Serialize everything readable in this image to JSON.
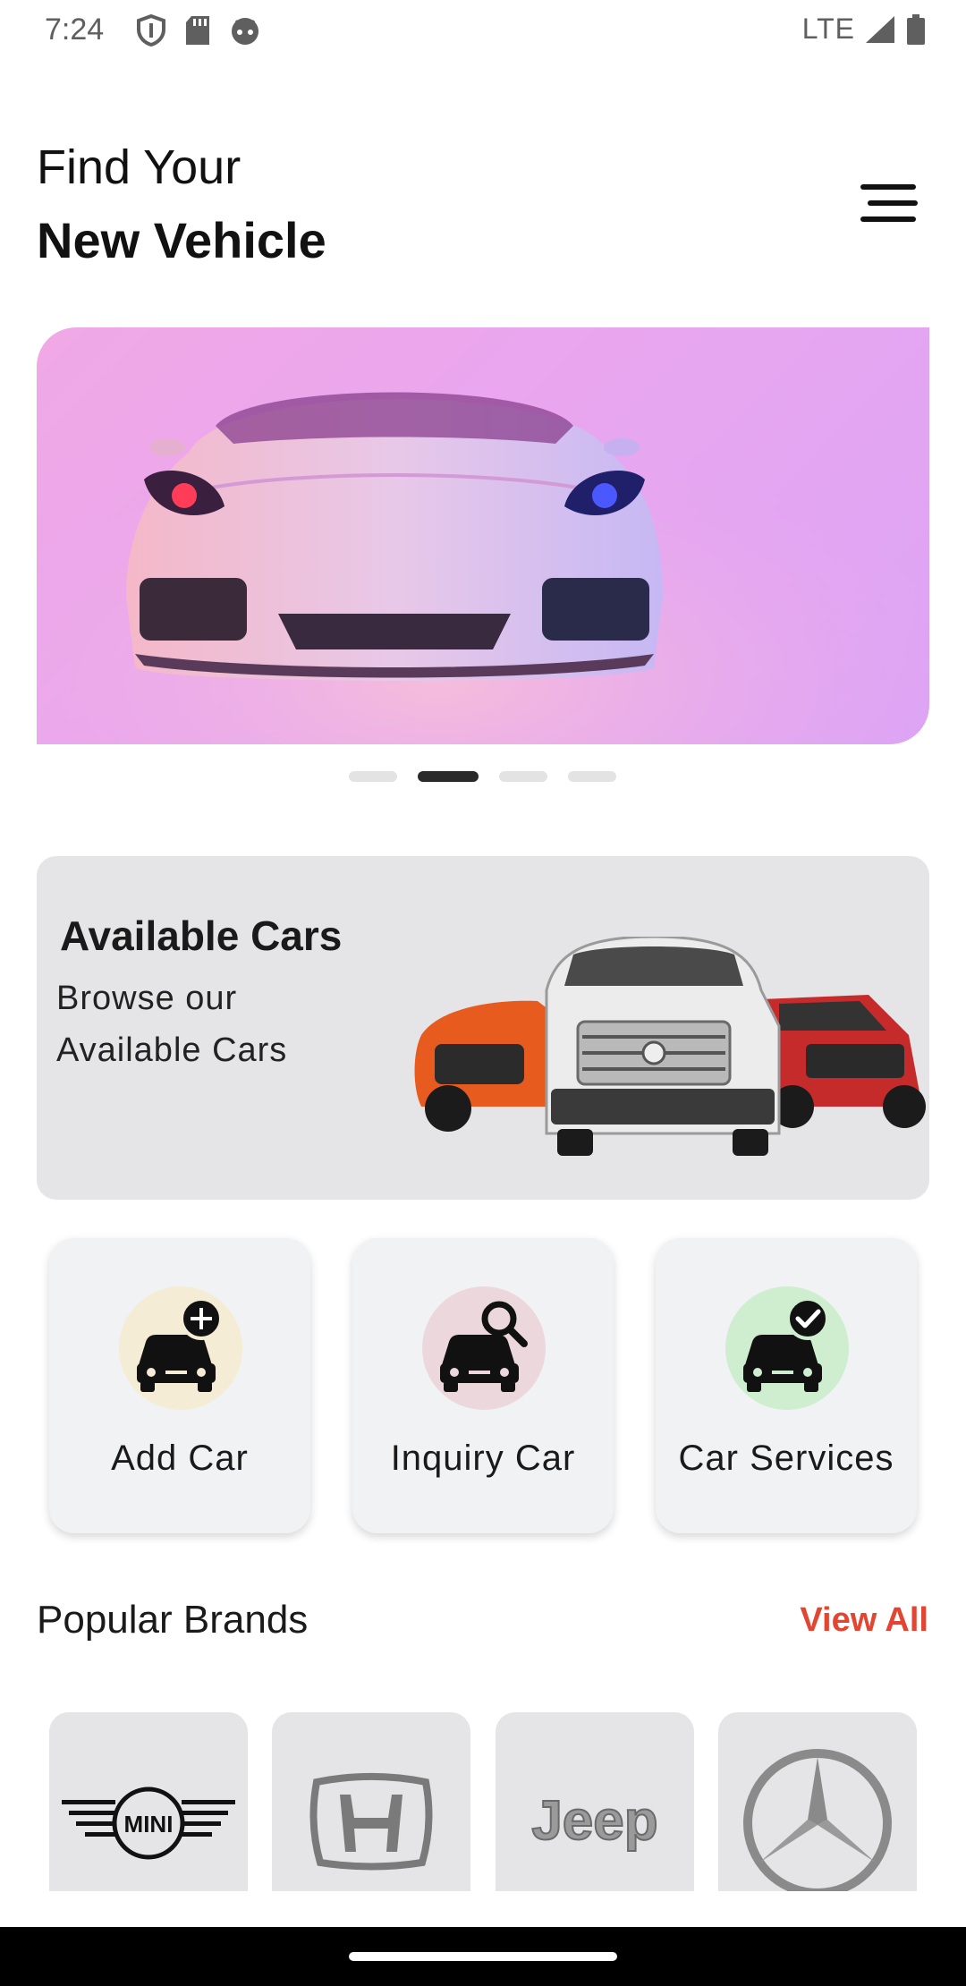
{
  "status_bar": {
    "time": "7:24",
    "network": "LTE",
    "icons_left": [
      "shield-icon",
      "sd-card-icon",
      "android-face-icon"
    ],
    "icons_right": [
      "signal-icon",
      "battery-icon"
    ]
  },
  "header": {
    "title_line1": "Find Your",
    "title_line2": "New Vehicle",
    "menu_icon": "menu-icon"
  },
  "carousel": {
    "slide_count": 4,
    "active_index": 1
  },
  "available_cars": {
    "title": "Available Cars",
    "subtitle": "Browse our Available Cars"
  },
  "actions": [
    {
      "label": "Add Car",
      "icon": "car-add-icon",
      "circle_color": "#f4ecd4"
    },
    {
      "label": "Inquiry Car",
      "icon": "car-search-icon",
      "circle_color": "#ecd8dc"
    },
    {
      "label": "Car Services",
      "icon": "car-check-icon",
      "circle_color": "#cfeecf"
    }
  ],
  "popular_brands": {
    "title": "Popular Brands",
    "view_all": "View All",
    "brands": [
      {
        "name": "MINI",
        "logo": "mini-logo"
      },
      {
        "name": "Honda",
        "logo": "honda-logo"
      },
      {
        "name": "Jeep",
        "logo": "jeep-logo"
      },
      {
        "name": "Mercedes-Benz",
        "logo": "mercedes-logo"
      }
    ]
  },
  "colors": {
    "accent": "#e24531",
    "card_bg": "#e5e5e7",
    "tile_bg": "#f1f2f4"
  }
}
